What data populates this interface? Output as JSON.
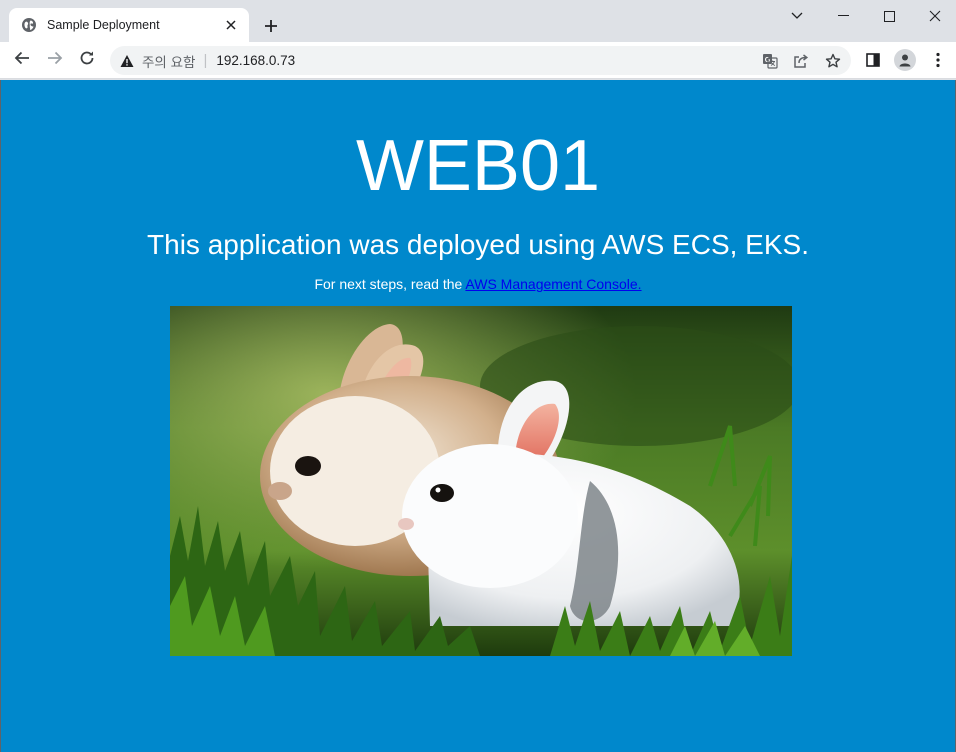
{
  "browser": {
    "tab": {
      "title": "Sample Deployment",
      "favicon": "globe-icon"
    },
    "address_bar": {
      "security_label": "주의 요함",
      "separator": "|",
      "url": "192.168.0.73"
    },
    "icons": [
      "back-arrow-icon",
      "forward-arrow-icon",
      "reload-icon",
      "warning-icon",
      "translate-icon",
      "share-icon",
      "bookmark-star-icon",
      "side-panel-icon",
      "profile-icon",
      "more-menu-icon"
    ]
  },
  "page": {
    "background_color": "#0088cc",
    "heading": "WEB01",
    "subheading": "This application was deployed using AWS ECS, EKS.",
    "next_steps_prefix": "For next steps, read the",
    "link_text": "AWS Management Console."
  }
}
